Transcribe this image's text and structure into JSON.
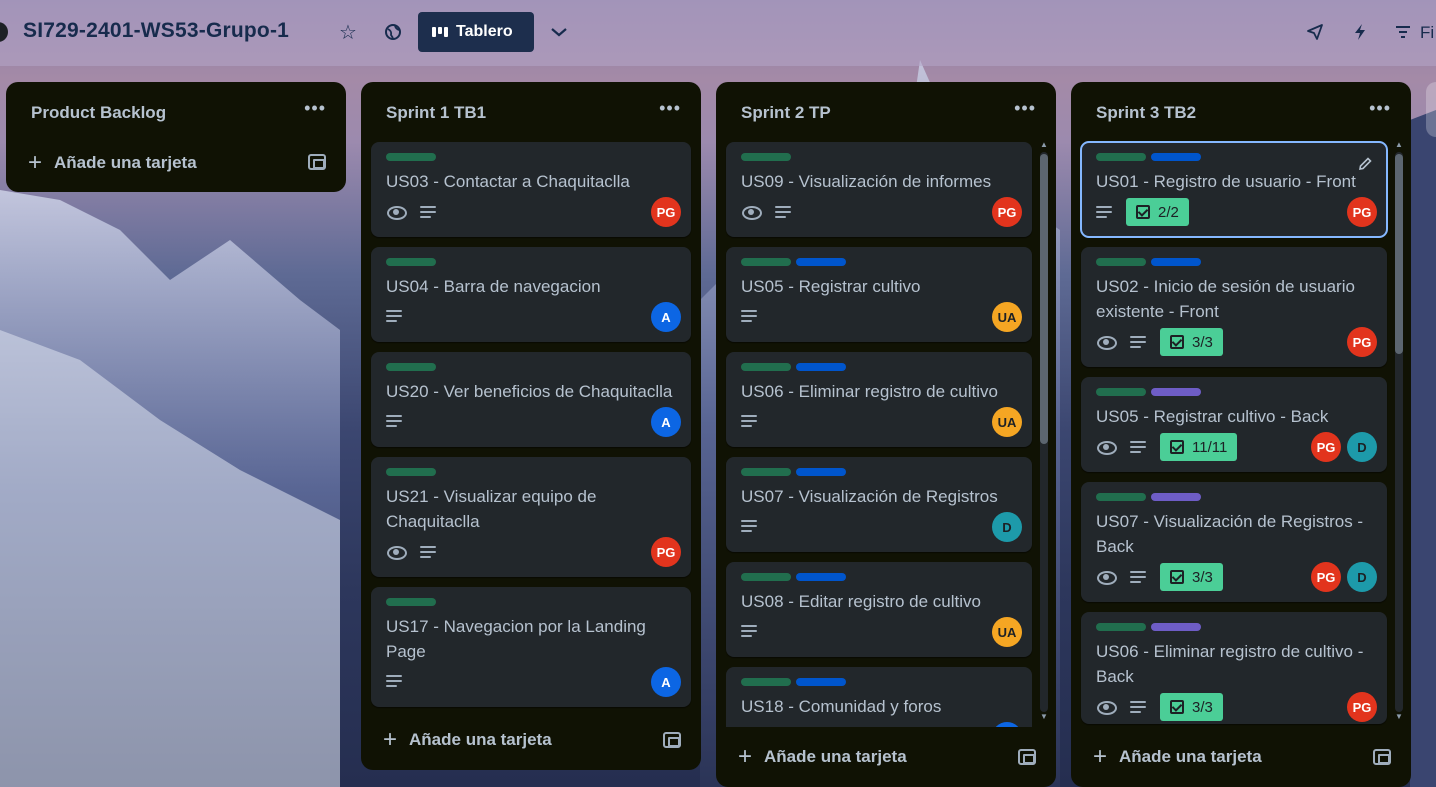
{
  "header": {
    "board_title": "SI729-2401-WS53-Grupo-1",
    "view_label": "Tablero",
    "filter_label": "Fi"
  },
  "lists": [
    {
      "title": "Product Backlog",
      "add_card": "Añade una tarjeta",
      "cards": []
    },
    {
      "title": "Sprint 1 TB1",
      "add_card": "Añade una tarjeta",
      "cards": [
        {
          "title": "US03 - Contactar a Chaquitaclla",
          "members": [
            "PG"
          ]
        },
        {
          "title": "US04 - Barra de navegacion",
          "members": [
            "A"
          ]
        },
        {
          "title": "US20 - Ver beneficios de Chaquitaclla",
          "members": [
            "A"
          ]
        },
        {
          "title": "US21 - Visualizar equipo de Chaquitaclla",
          "members": [
            "PG"
          ]
        },
        {
          "title": "US17 - Navegacion por la Landing Page",
          "members": [
            "A"
          ]
        }
      ]
    },
    {
      "title": "Sprint 2 TP",
      "add_card": "Añade una tarjeta",
      "cards": [
        {
          "title": "US09 - Visualización de informes",
          "members": [
            "PG"
          ]
        },
        {
          "title": "US05 - Registrar cultivo",
          "members": [
            "UA"
          ]
        },
        {
          "title": "US06 - Eliminar registro de cultivo",
          "members": [
            "UA"
          ]
        },
        {
          "title": "US07 - Visualización de Registros",
          "members": [
            "D"
          ]
        },
        {
          "title": "US08 - Editar registro de cultivo",
          "members": [
            "UA"
          ]
        },
        {
          "title": "US18 - Comunidad y foros",
          "members": []
        }
      ]
    },
    {
      "title": "Sprint 3 TB2",
      "add_card": "Añade una tarjeta",
      "cards": [
        {
          "title": "US01 - Registro de usuario - Front",
          "checklist": "2/2",
          "members": [
            "PG"
          ]
        },
        {
          "title": "US02 - Inicio de sesión de usuario existente - Front",
          "checklist": "3/3",
          "members": [
            "PG"
          ]
        },
        {
          "title": "US05 - Registrar cultivo - Back",
          "checklist": "11/11",
          "members": [
            "PG",
            "D"
          ]
        },
        {
          "title": "US07 - Visualización de Registros - Back",
          "checklist": "3/3",
          "members": [
            "PG",
            "D"
          ]
        },
        {
          "title": "US06 - Eliminar registro de cultivo - Back",
          "checklist": "3/3",
          "members": [
            "PG"
          ]
        }
      ]
    }
  ],
  "colors": {
    "list_bg": "#101204",
    "card_bg": "#22272b",
    "label_green": "#216e4e",
    "label_blue": "#0055cc",
    "label_purple": "#6e5dc6",
    "checklist_complete": "#4bce97"
  }
}
